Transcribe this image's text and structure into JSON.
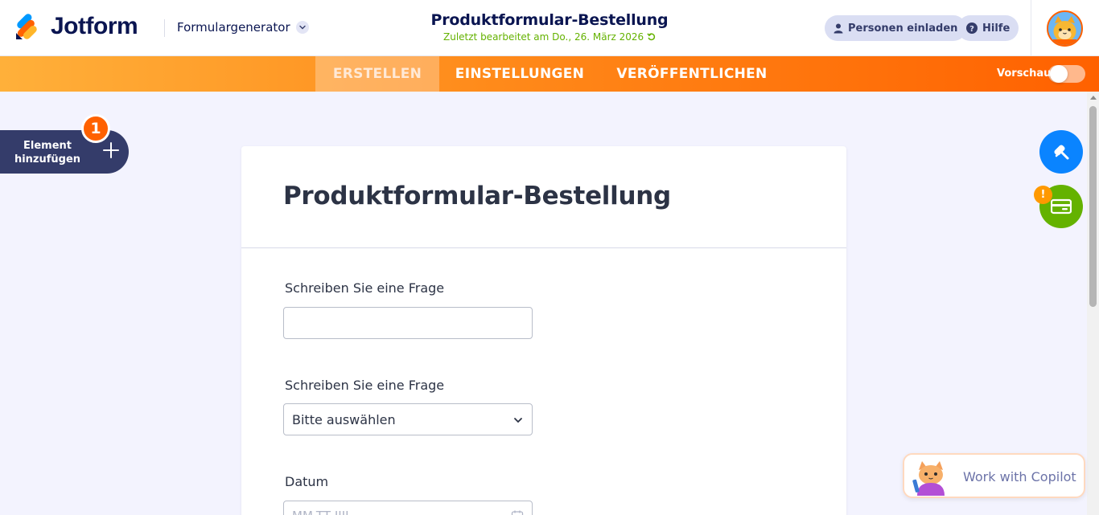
{
  "header": {
    "logo_text": "Jotform",
    "builder_label": "Formulargenerator",
    "form_title": "Produktformular-Bestellung",
    "last_edited": "Zuletzt bearbeitet am Do., 26. März 2026",
    "invite_label": "Personen einladen",
    "help_label": "Hilfe"
  },
  "nav": {
    "tabs": [
      {
        "label": "ERSTELLEN",
        "active": true
      },
      {
        "label": "EINSTELLUNGEN",
        "active": false
      },
      {
        "label": "VERÖFFENTLICHEN",
        "active": false
      }
    ],
    "preview_label": "Vorschau",
    "preview_on": false
  },
  "sidebar": {
    "add_element_label": "Element hinzufügen",
    "add_element_badge": "1"
  },
  "form": {
    "title": "Produktformular-Bestellung",
    "fields": [
      {
        "label": "Schreiben Sie eine Frage",
        "type": "text",
        "value": ""
      },
      {
        "label": "Schreiben Sie eine Frage",
        "type": "select",
        "value": "Bitte auswählen"
      },
      {
        "label": "Datum",
        "type": "date",
        "placeholder": "MM-TT-JJJJ"
      }
    ]
  },
  "right_tools": {
    "payment_warning": "!"
  },
  "copilot": {
    "label": "Work with Copilot"
  },
  "colors": {
    "brand_navy": "#0a1551",
    "accent_orange": "#ff6100",
    "edit_green": "#64b200",
    "fab_blue": "#0a84ff",
    "fab_green": "#64b200"
  },
  "icons": [
    "jotform-logo-icon",
    "chevron-down-icon",
    "person-icon",
    "help-icon",
    "refresh-icon",
    "plus-icon",
    "paint-roller-icon",
    "payment-card-icon",
    "calendar-icon",
    "avatar-icon"
  ]
}
